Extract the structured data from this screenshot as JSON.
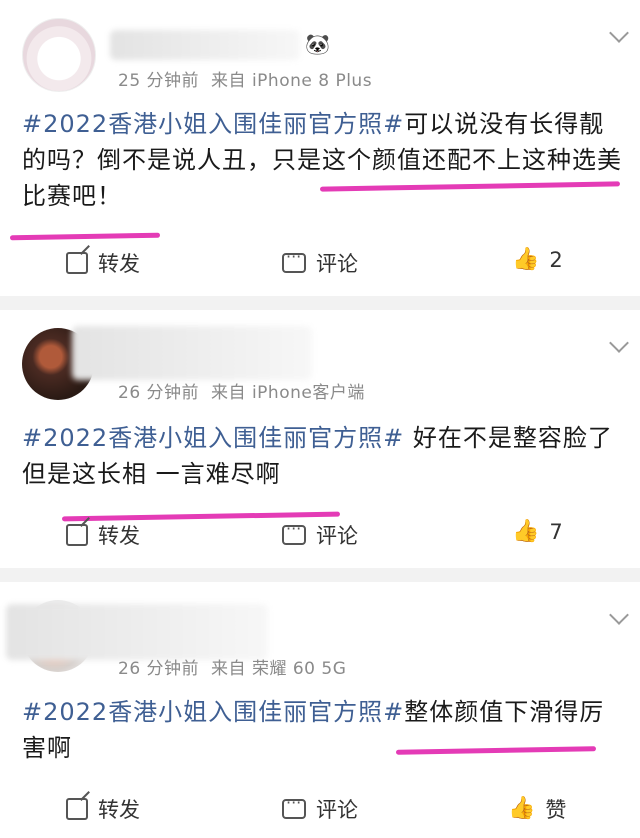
{
  "posts": [
    {
      "meta_time": "25 分钟前",
      "meta_source": "来自 iPhone 8 Plus",
      "hashtag": "#2022香港小姐入围佳丽官方照#",
      "text": "可以说没有长得靓的吗？倒不是说人丑，只是这个颜值还配不上这种选美比赛吧！",
      "actions": {
        "repost": "转发",
        "comment": "评论",
        "like": "2"
      }
    },
    {
      "meta_time": "26 分钟前",
      "meta_source": "来自 iPhone客户端",
      "hashtag": "#2022香港小姐入围佳丽官方照#",
      "text": " 好在不是整容脸了 但是这长相 一言难尽啊",
      "actions": {
        "repost": "转发",
        "comment": "评论",
        "like": "7"
      }
    },
    {
      "meta_time": "26 分钟前",
      "meta_source": "来自 荣耀 60 5G",
      "hashtag": "#2022香港小姐入围佳丽官方照#",
      "text": "整体颜值下滑得厉害啊",
      "actions": {
        "repost": "转发",
        "comment": "评论",
        "like": "赞"
      }
    }
  ],
  "icons": {
    "repost": "share-square-icon",
    "comment": "comment-bubble-icon",
    "like": "thumbs-up-icon",
    "caret": "chevron-down-icon",
    "emoji": "panda-emoji-icon"
  },
  "colors": {
    "hashtag": "#3f5f93",
    "underline": "#e43bb6",
    "meta": "#8a8a8a"
  }
}
